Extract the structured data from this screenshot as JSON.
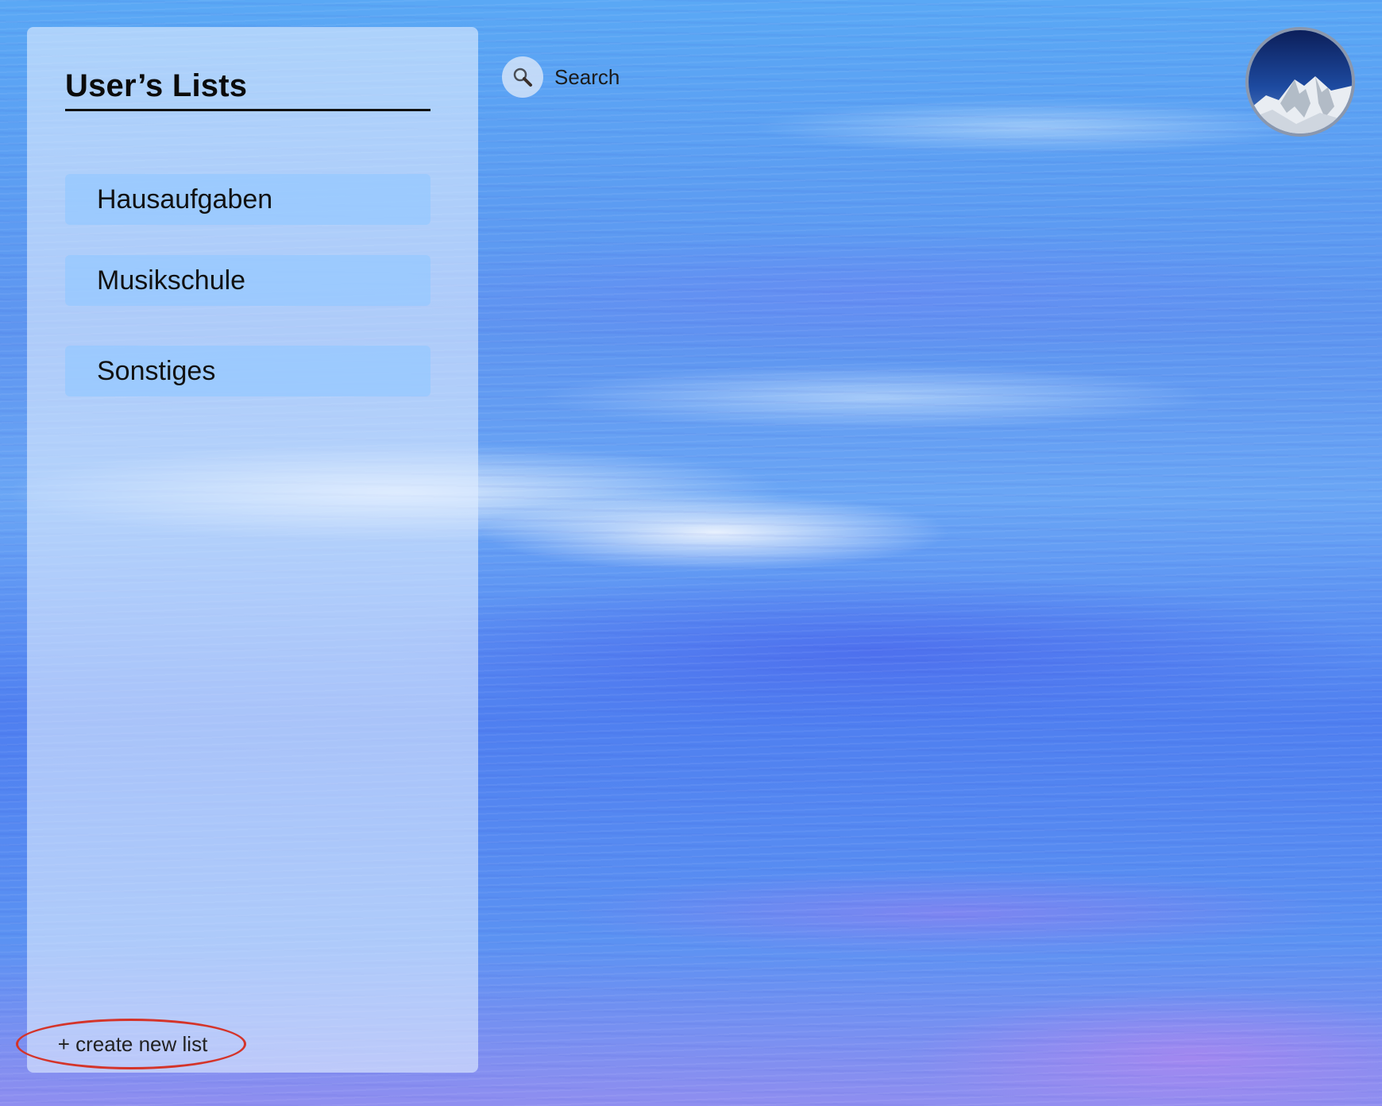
{
  "sidebar": {
    "title": "User’s Lists",
    "lists": [
      {
        "label": "Hausaufgaben"
      },
      {
        "label": "Musikschule"
      },
      {
        "label": "Sonstiges"
      }
    ],
    "create_label": "+ create new list"
  },
  "search": {
    "label": "Search",
    "icon": "magnifier-icon"
  },
  "avatar": {
    "icon": "mountain-avatar"
  },
  "colors": {
    "list_button": "#96c8ff",
    "highlight_ellipse": "#d4342a",
    "sidebar_panel": "#e1eeff"
  }
}
